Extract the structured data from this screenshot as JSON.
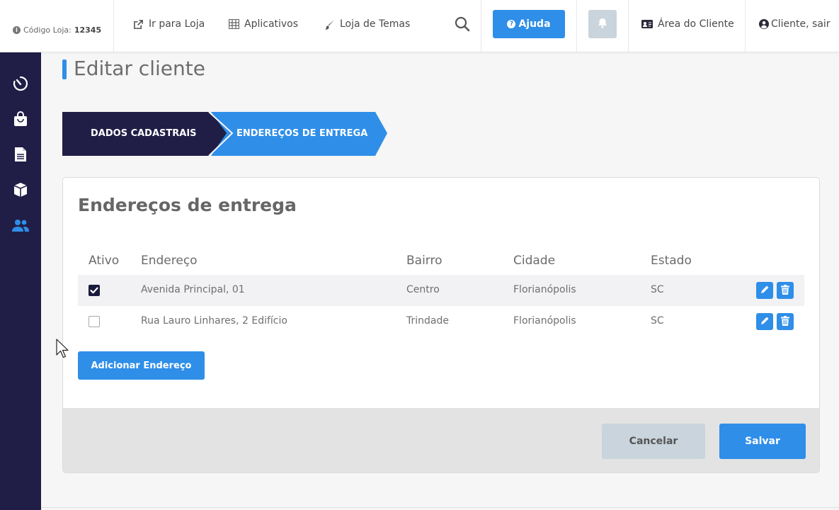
{
  "header": {
    "store_code_label": "Código Loja:",
    "store_code_value": "12345",
    "links": [
      {
        "label": "Ir para Loja",
        "icon": "external-link-icon"
      },
      {
        "label": "Aplicativos",
        "icon": "grid-icon"
      },
      {
        "label": "Loja de Temas",
        "icon": "brush-icon"
      }
    ],
    "help_label": "Ajuda",
    "client_area_label": "Área do Cliente",
    "logout_label": "Cliente, sair",
    "colors": {
      "accent": "#2f8ee8",
      "sidebar": "#201e47",
      "muted_button": "#c9d4dc"
    }
  },
  "sidebar": {
    "items": [
      {
        "icon": "dashboard-timer-icon",
        "active": false
      },
      {
        "icon": "shopping-bag-icon",
        "active": false
      },
      {
        "icon": "document-icon",
        "active": false
      },
      {
        "icon": "box-icon",
        "active": false
      },
      {
        "icon": "users-icon",
        "active": true
      }
    ]
  },
  "page": {
    "title": "Editar cliente",
    "steps": [
      {
        "label": "DADOS CADASTRAIS",
        "active": false
      },
      {
        "label": "ENDEREÇOS DE ENTREGA",
        "active": true
      }
    ]
  },
  "addresses": {
    "title": "Endereços de entrega",
    "columns": [
      "Ativo",
      "Endereço",
      "Bairro",
      "Cidade",
      "Estado"
    ],
    "rows": [
      {
        "active": true,
        "address": "Avenida Principal, 01",
        "district": "Centro",
        "city": "Florianópolis",
        "state": "SC"
      },
      {
        "active": false,
        "address": "Rua Lauro Linhares, 2 Edifício",
        "district": "Trindade",
        "city": "Florianópolis",
        "state": "SC"
      }
    ],
    "add_label": "Adicionar Endereço"
  },
  "footer": {
    "cancel_label": "Cancelar",
    "save_label": "Salvar"
  }
}
